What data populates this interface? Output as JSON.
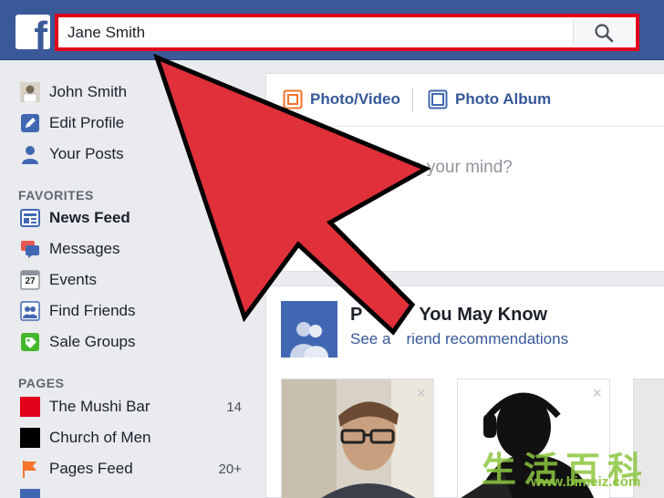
{
  "search": {
    "value": "Jane Smith"
  },
  "profile": {
    "name": "John Smith",
    "edit": "Edit Profile",
    "posts": "Your Posts"
  },
  "favorites": {
    "heading": "FAVORITES",
    "items": [
      {
        "label": "News Feed",
        "icon": "news-feed-icon"
      },
      {
        "label": "Messages",
        "icon": "messages-icon"
      },
      {
        "label": "Events",
        "icon": "events-icon",
        "icon_text": "27"
      },
      {
        "label": "Find Friends",
        "icon": "find-friends-icon"
      },
      {
        "label": "Sale Groups",
        "icon": "sale-groups-icon"
      }
    ]
  },
  "pages": {
    "heading": "PAGES",
    "items": [
      {
        "label": "The Mushi Bar",
        "count": "14",
        "color": "#e3001b"
      },
      {
        "label": "Church of Men",
        "count": "",
        "color": "#000000"
      },
      {
        "label": "Pages Feed",
        "count": "20+",
        "color": "#f5732a"
      }
    ]
  },
  "composer": {
    "tabs": [
      {
        "label": "Photo/Video",
        "icon": "photo-video-icon"
      },
      {
        "label": "Photo Album",
        "icon": "photo-album-icon"
      }
    ],
    "prompt_visible": "n your mind?"
  },
  "pymk": {
    "title_visible_prefix": "P",
    "title_visible_suffix": "You May Know",
    "link_prefix": "See a",
    "link_suffix": "riend recommendations",
    "close_glyph": "×"
  },
  "watermark": {
    "chars": "生活百科",
    "url": "www.bimeiz.com"
  },
  "colors": {
    "header_blue": "#3b5998",
    "link_blue": "#365899",
    "annotation_red": "#e3001b",
    "arrow_red": "#e0303a",
    "watermark_green": "#8cc63f"
  }
}
